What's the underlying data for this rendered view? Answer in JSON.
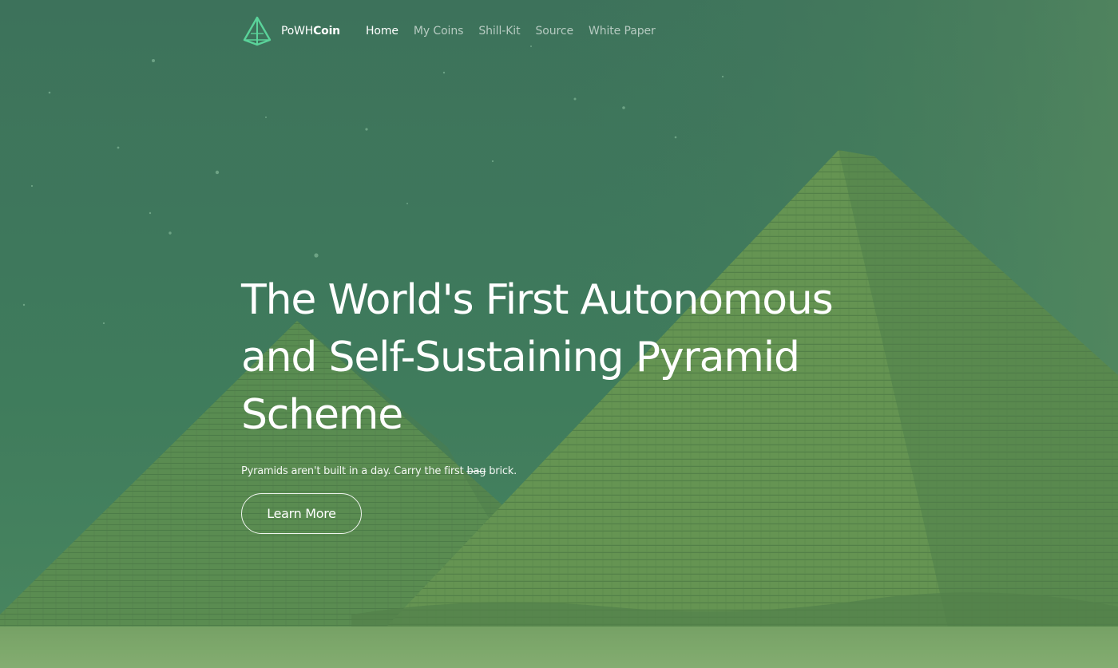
{
  "colors": {
    "overlay": "#3f7a5c",
    "sky_top": "#3c6f5b",
    "pyramid": "#6f9a4f",
    "pyramid_shadow": "#557f48",
    "ground": "#87ab6b",
    "logo": "#5ad39a",
    "text": "#ffffff"
  },
  "nav": {
    "brand": {
      "logo_icon": "pyramid-icon",
      "name_light": "PoWH",
      "name_bold": "Coin"
    },
    "links": [
      {
        "label": "Home",
        "active": true
      },
      {
        "label": "My Coins",
        "active": false
      },
      {
        "label": "Shill-Kit",
        "active": false
      },
      {
        "label": "Source",
        "active": false
      },
      {
        "label": "White Paper",
        "active": false
      }
    ]
  },
  "hero": {
    "headline_line1": "The World's First Autonomous",
    "headline_line2": "and Self-Sustaining Pyramid",
    "headline_line3": "Scheme",
    "tagline_before": "Pyramids aren't built in a day. Carry the first ",
    "tagline_struck": "bag",
    "tagline_after": " brick.",
    "cta_label": "Learn More"
  }
}
